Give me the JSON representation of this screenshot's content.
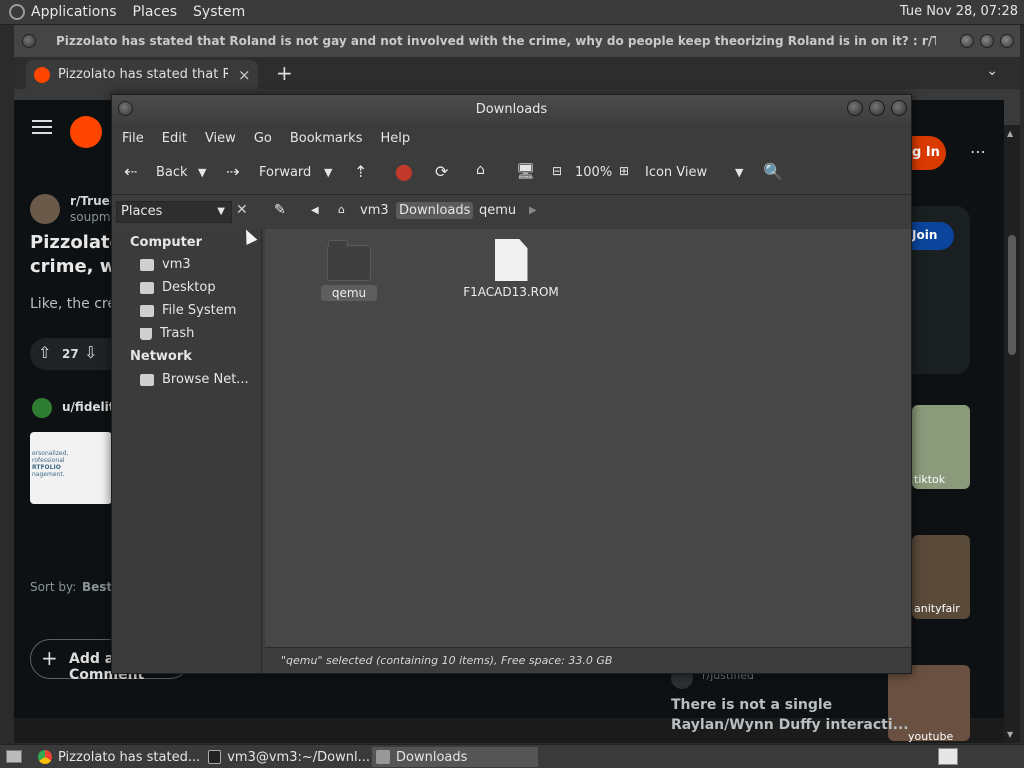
{
  "top_panel": {
    "menus": [
      "Applications",
      "Places",
      "System"
    ],
    "clock": "Tue Nov 28, 07:28"
  },
  "browser": {
    "window_title": "Pizzolato has stated that Roland is not gay and not involved with the crime, why do people keep theorizing Roland is in on it? : r/TrueDetective...",
    "tab_label": "Pizzolato has stated that Rola",
    "new_tab": "+",
    "tab_close": "×"
  },
  "reddit": {
    "subreddit": "r/TrueD",
    "user": "soupma",
    "post_title_line1": "Pizzolato",
    "post_title_line2": "crime, wh",
    "post_body": "Like, the crea",
    "votes": "27",
    "ad_user": "u/fidelity",
    "ad_text": [
      "ersonalized,",
      "rofessional",
      "RTFOLIO",
      "nagement."
    ],
    "login_label": "g In",
    "join_label": "Join",
    "sort_label": "Sort by:",
    "sort_value": "Best",
    "add_comment": "Add a Comment",
    "related_user": "r/justified",
    "related_text_line1": "There is not a single",
    "related_text_line2": "Raylan/Wynn Duffy interacti...",
    "thumb_tiktok": "tiktok",
    "thumb_vanity": "anityfair",
    "thumb_youtube": "youtube"
  },
  "file_manager": {
    "title": "Downloads",
    "menus": [
      "File",
      "Edit",
      "View",
      "Go",
      "Bookmarks",
      "Help"
    ],
    "toolbar": {
      "back": "Back",
      "forward": "Forward",
      "zoom": "100%",
      "view_mode": "Icon View"
    },
    "side_pane_selector": "Places",
    "breadcrumbs": [
      "vm3",
      "Downloads",
      "qemu"
    ],
    "sidebar": {
      "computer_header": "Computer",
      "computer_items": [
        "vm3",
        "Desktop",
        "File System",
        "Trash"
      ],
      "network_header": "Network",
      "network_items": [
        "Browse Net..."
      ]
    },
    "files": [
      {
        "name": "qemu",
        "type": "folder",
        "selected": true
      },
      {
        "name": "F1ACAD13.ROM",
        "type": "file",
        "selected": false
      }
    ],
    "status": "\"qemu\" selected (containing 10 items), Free space: 33.0 GB"
  },
  "taskbar": {
    "tasks": [
      "Pizzolato has stated...",
      "vm3@vm3:~/Downl...",
      "Downloads"
    ]
  }
}
